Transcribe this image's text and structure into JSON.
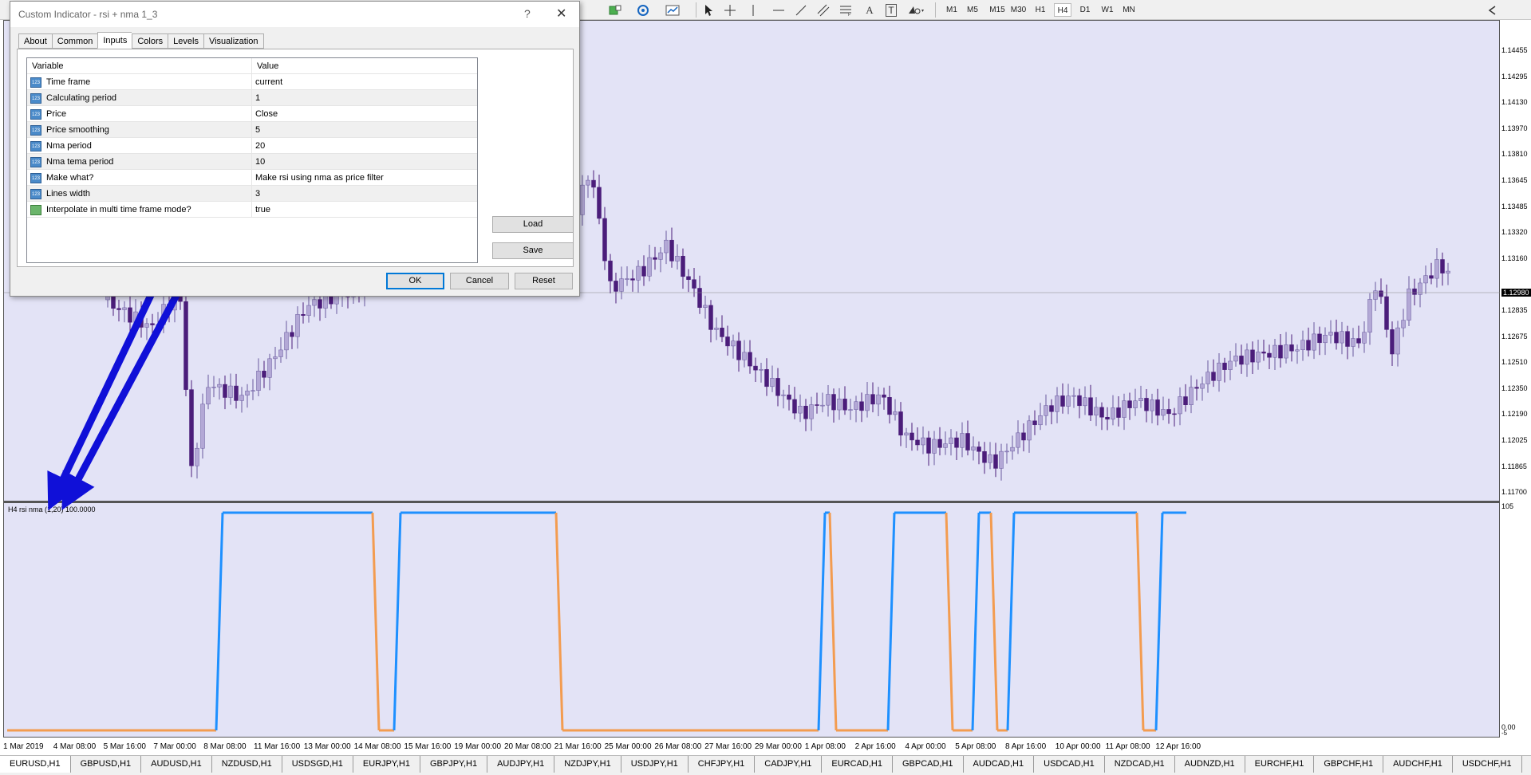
{
  "toolbar": {
    "timeframes": [
      "M1",
      "M5",
      "M15",
      "M30",
      "H1",
      "H4",
      "D1",
      "W1",
      "MN"
    ],
    "active_timeframe": "H4",
    "tool_icons": [
      "new-order-icon",
      "navigate-icon",
      "chart-type-icon",
      "cursor-icon",
      "crosshair-icon",
      "hline-icon",
      "trendline-icon",
      "channel-icon",
      "fibo-icon",
      "text-icon",
      "label-icon",
      "shapes-icon"
    ],
    "text_tool": "A",
    "label_tool": "T"
  },
  "dialog": {
    "title": "Custom Indicator - rsi + nma 1_3",
    "help": "?",
    "close": "✕",
    "tabs": [
      "About",
      "Common",
      "Inputs",
      "Colors",
      "Levels",
      "Visualization"
    ],
    "active_tab": "Inputs",
    "grid_headers": {
      "variable": "Variable",
      "value": "Value"
    },
    "rows": [
      {
        "variable": "Time frame",
        "value": "current",
        "icon": "int-icon"
      },
      {
        "variable": "Calculating period",
        "value": "1",
        "icon": "int-icon"
      },
      {
        "variable": "Price",
        "value": "Close",
        "icon": "int-icon"
      },
      {
        "variable": "Price smoothing",
        "value": "5",
        "icon": "int-icon"
      },
      {
        "variable": "Nma period",
        "value": "20",
        "icon": "int-icon"
      },
      {
        "variable": "Nma tema period",
        "value": "10",
        "icon": "int-icon"
      },
      {
        "variable": "Make what?",
        "value": "Make rsi using nma as price filter",
        "icon": "int-icon"
      },
      {
        "variable": "Lines width",
        "value": "3",
        "icon": "int-icon"
      },
      {
        "variable": "Interpolate in multi time frame mode?",
        "value": "true",
        "icon": "bool-icon"
      }
    ],
    "icon_text": "123",
    "buttons": {
      "load": "Load",
      "save": "Save",
      "ok": "OK",
      "cancel": "Cancel",
      "reset": "Reset"
    }
  },
  "main_chart": {
    "price_labels": [
      "1.14455",
      "1.14295",
      "1.14130",
      "1.13970",
      "1.13810",
      "1.13645",
      "1.13485",
      "1.13320",
      "1.13160",
      "1.12980",
      "1.12835",
      "1.12675",
      "1.12510",
      "1.12350",
      "1.12190",
      "1.12025",
      "1.11865",
      "1.11700"
    ],
    "current_price": "1.12980",
    "bull_color": "#b3a8d6",
    "bear_color": "#4b1d7a"
  },
  "indicator": {
    "label": "H4 rsi nma (1,20) 100.0000",
    "axis_labels": {
      "top": "105",
      "zero": "0.00",
      "bottom": "-5"
    },
    "up_color": "#1e90ff",
    "down_color": "#f39c50"
  },
  "time_labels": [
    "1 Mar 2019",
    "4 Mar 08:00",
    "5 Mar 16:00",
    "7 Mar 00:00",
    "8 Mar 08:00",
    "11 Mar 16:00",
    "13 Mar 00:00",
    "14 Mar 08:00",
    "15 Mar 16:00",
    "19 Mar 00:00",
    "20 Mar 08:00",
    "21 Mar 16:00",
    "25 Mar 00:00",
    "26 Mar 08:00",
    "27 Mar 16:00",
    "29 Mar 00:00",
    "1 Apr 08:00",
    "2 Apr 16:00",
    "4 Apr 00:00",
    "5 Apr 08:00",
    "8 Apr 16:00",
    "10 Apr 00:00",
    "11 Apr 08:00",
    "12 Apr 16:00"
  ],
  "symbol_tabs": [
    "EURUSD,H1",
    "GBPUSD,H1",
    "AUDUSD,H1",
    "NZDUSD,H1",
    "USDSGD,H1",
    "EURJPY,H1",
    "GBPJPY,H1",
    "AUDJPY,H1",
    "NZDJPY,H1",
    "USDJPY,H1",
    "CHFJPY,H1",
    "CADJPY,H1",
    "EURCAD,H1",
    "GBPCAD,H1",
    "AUDCAD,H1",
    "USDCAD,H1",
    "NZDCAD,H1",
    "AUDNZD,H1",
    "EURCHF,H1",
    "GBPCHF,H1",
    "AUDCHF,H1",
    "USDCHF,H1"
  ],
  "active_symbol": "EURUSD,H1",
  "annotation_color": "#1010d8"
}
